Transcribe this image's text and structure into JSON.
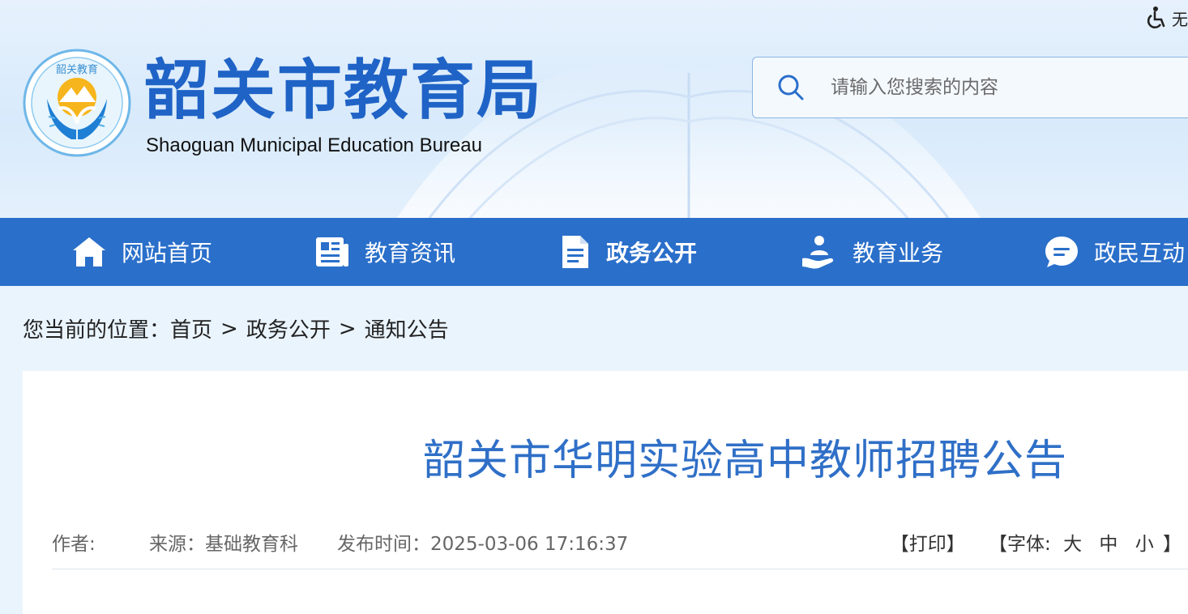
{
  "header": {
    "accessibility_label": "无",
    "logo_title": "韶关市教育局",
    "logo_subtitle": "Shaoguan Municipal Education Bureau",
    "emblem_text": "韶关教育"
  },
  "search": {
    "placeholder": "请输入您搜索的内容"
  },
  "nav": {
    "items": [
      {
        "label": "网站首页",
        "icon": "home-icon"
      },
      {
        "label": "教育资讯",
        "icon": "news-icon"
      },
      {
        "label": "政务公开",
        "icon": "document-icon",
        "active": true
      },
      {
        "label": "教育业务",
        "icon": "service-icon"
      },
      {
        "label": "政民互动",
        "icon": "chat-icon"
      }
    ]
  },
  "breadcrumb": {
    "prefix": "您当前的位置：",
    "items": [
      "首页",
      "政务公开",
      "通知公告"
    ],
    "separator": ">"
  },
  "article": {
    "title": "韶关市华明实验高中教师招聘公告",
    "author_label": "作者:",
    "source": "来源：基础教育科",
    "publish_time": "发布时间：2025-03-06 17:16:37",
    "print_label": "【打印】",
    "font_size_prefix": "【字体:",
    "font_large": "大",
    "font_medium": "中",
    "font_small": "小",
    "font_size_suffix": "】"
  },
  "colors": {
    "brand_blue": "#1f63c6",
    "nav_blue": "#2a6fca",
    "title_blue": "#2f6fc7"
  }
}
